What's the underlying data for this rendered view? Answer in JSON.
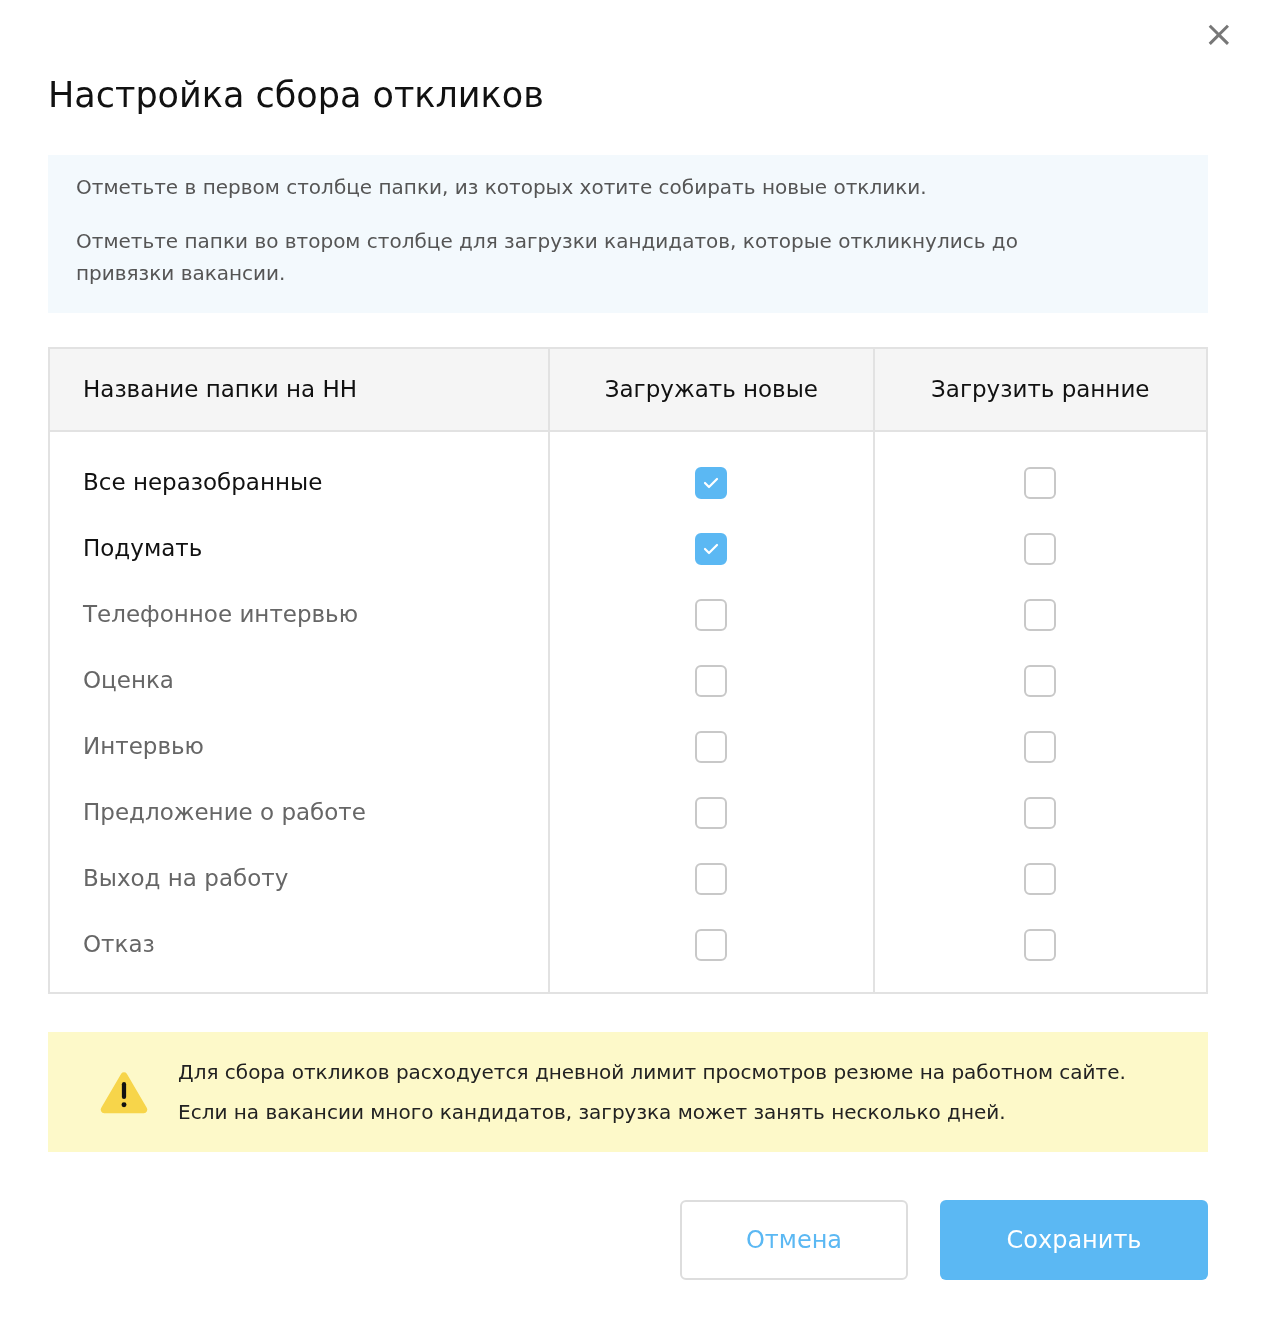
{
  "dialog": {
    "title": "Настройка сбора откликов",
    "close": "×"
  },
  "info": [
    "Отметьте в первом столбце папки, из которых хотите собирать новые отклики.",
    "Отметьте папки во втором столбце для загрузки кандидатов, которые откликнулись до привязки вакансии."
  ],
  "table": {
    "columns": [
      "Название папки на НН",
      "Загружать новые",
      "Загрузить ранние"
    ],
    "rows": [
      {
        "folder": "Все неразобранные",
        "load_new": true,
        "load_early": false
      },
      {
        "folder": "Подумать",
        "load_new": true,
        "load_early": false
      },
      {
        "folder": "Телефонное интервью",
        "load_new": false,
        "load_early": false
      },
      {
        "folder": "Оценка",
        "load_new": false,
        "load_early": false
      },
      {
        "folder": "Интервью",
        "load_new": false,
        "load_early": false
      },
      {
        "folder": "Предложение о работе",
        "load_new": false,
        "load_early": false
      },
      {
        "folder": "Выход на работу",
        "load_new": false,
        "load_early": false
      },
      {
        "folder": "Отказ",
        "load_new": false,
        "load_early": false
      }
    ]
  },
  "warning": "Для сбора откликов расходуется дневной лимит просмотров резюме на работном сайте. Если на вакансии много кандидатов, загрузка может занять несколько дней.",
  "buttons": [
    {
      "label": "Отмена",
      "kind": "secondary"
    },
    {
      "label": "Сохранить",
      "kind": "primary"
    }
  ]
}
